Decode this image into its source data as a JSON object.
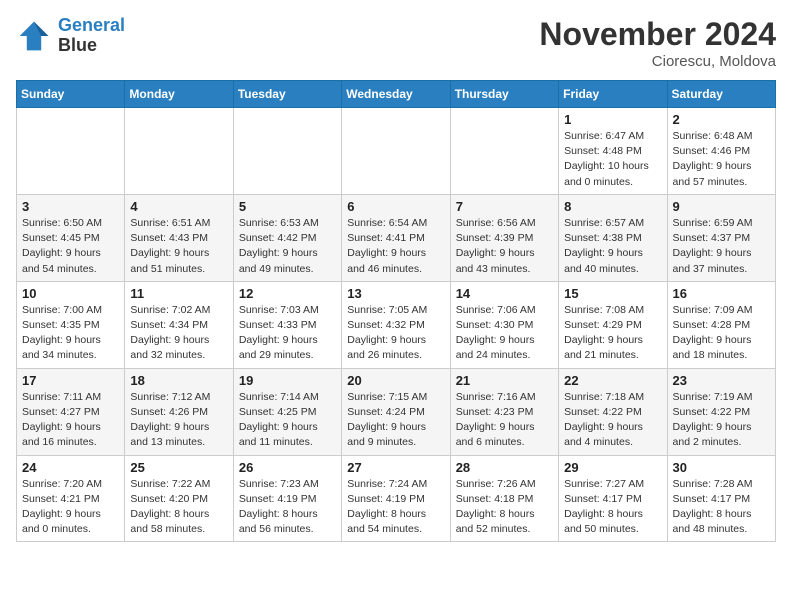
{
  "header": {
    "logo_line1": "General",
    "logo_line2": "Blue",
    "month": "November 2024",
    "location": "Ciorescu, Moldova"
  },
  "weekdays": [
    "Sunday",
    "Monday",
    "Tuesday",
    "Wednesday",
    "Thursday",
    "Friday",
    "Saturday"
  ],
  "weeks": [
    [
      {
        "day": "",
        "info": ""
      },
      {
        "day": "",
        "info": ""
      },
      {
        "day": "",
        "info": ""
      },
      {
        "day": "",
        "info": ""
      },
      {
        "day": "",
        "info": ""
      },
      {
        "day": "1",
        "info": "Sunrise: 6:47 AM\nSunset: 4:48 PM\nDaylight: 10 hours\nand 0 minutes."
      },
      {
        "day": "2",
        "info": "Sunrise: 6:48 AM\nSunset: 4:46 PM\nDaylight: 9 hours\nand 57 minutes."
      }
    ],
    [
      {
        "day": "3",
        "info": "Sunrise: 6:50 AM\nSunset: 4:45 PM\nDaylight: 9 hours\nand 54 minutes."
      },
      {
        "day": "4",
        "info": "Sunrise: 6:51 AM\nSunset: 4:43 PM\nDaylight: 9 hours\nand 51 minutes."
      },
      {
        "day": "5",
        "info": "Sunrise: 6:53 AM\nSunset: 4:42 PM\nDaylight: 9 hours\nand 49 minutes."
      },
      {
        "day": "6",
        "info": "Sunrise: 6:54 AM\nSunset: 4:41 PM\nDaylight: 9 hours\nand 46 minutes."
      },
      {
        "day": "7",
        "info": "Sunrise: 6:56 AM\nSunset: 4:39 PM\nDaylight: 9 hours\nand 43 minutes."
      },
      {
        "day": "8",
        "info": "Sunrise: 6:57 AM\nSunset: 4:38 PM\nDaylight: 9 hours\nand 40 minutes."
      },
      {
        "day": "9",
        "info": "Sunrise: 6:59 AM\nSunset: 4:37 PM\nDaylight: 9 hours\nand 37 minutes."
      }
    ],
    [
      {
        "day": "10",
        "info": "Sunrise: 7:00 AM\nSunset: 4:35 PM\nDaylight: 9 hours\nand 34 minutes."
      },
      {
        "day": "11",
        "info": "Sunrise: 7:02 AM\nSunset: 4:34 PM\nDaylight: 9 hours\nand 32 minutes."
      },
      {
        "day": "12",
        "info": "Sunrise: 7:03 AM\nSunset: 4:33 PM\nDaylight: 9 hours\nand 29 minutes."
      },
      {
        "day": "13",
        "info": "Sunrise: 7:05 AM\nSunset: 4:32 PM\nDaylight: 9 hours\nand 26 minutes."
      },
      {
        "day": "14",
        "info": "Sunrise: 7:06 AM\nSunset: 4:30 PM\nDaylight: 9 hours\nand 24 minutes."
      },
      {
        "day": "15",
        "info": "Sunrise: 7:08 AM\nSunset: 4:29 PM\nDaylight: 9 hours\nand 21 minutes."
      },
      {
        "day": "16",
        "info": "Sunrise: 7:09 AM\nSunset: 4:28 PM\nDaylight: 9 hours\nand 18 minutes."
      }
    ],
    [
      {
        "day": "17",
        "info": "Sunrise: 7:11 AM\nSunset: 4:27 PM\nDaylight: 9 hours\nand 16 minutes."
      },
      {
        "day": "18",
        "info": "Sunrise: 7:12 AM\nSunset: 4:26 PM\nDaylight: 9 hours\nand 13 minutes."
      },
      {
        "day": "19",
        "info": "Sunrise: 7:14 AM\nSunset: 4:25 PM\nDaylight: 9 hours\nand 11 minutes."
      },
      {
        "day": "20",
        "info": "Sunrise: 7:15 AM\nSunset: 4:24 PM\nDaylight: 9 hours\nand 9 minutes."
      },
      {
        "day": "21",
        "info": "Sunrise: 7:16 AM\nSunset: 4:23 PM\nDaylight: 9 hours\nand 6 minutes."
      },
      {
        "day": "22",
        "info": "Sunrise: 7:18 AM\nSunset: 4:22 PM\nDaylight: 9 hours\nand 4 minutes."
      },
      {
        "day": "23",
        "info": "Sunrise: 7:19 AM\nSunset: 4:22 PM\nDaylight: 9 hours\nand 2 minutes."
      }
    ],
    [
      {
        "day": "24",
        "info": "Sunrise: 7:20 AM\nSunset: 4:21 PM\nDaylight: 9 hours\nand 0 minutes."
      },
      {
        "day": "25",
        "info": "Sunrise: 7:22 AM\nSunset: 4:20 PM\nDaylight: 8 hours\nand 58 minutes."
      },
      {
        "day": "26",
        "info": "Sunrise: 7:23 AM\nSunset: 4:19 PM\nDaylight: 8 hours\nand 56 minutes."
      },
      {
        "day": "27",
        "info": "Sunrise: 7:24 AM\nSunset: 4:19 PM\nDaylight: 8 hours\nand 54 minutes."
      },
      {
        "day": "28",
        "info": "Sunrise: 7:26 AM\nSunset: 4:18 PM\nDaylight: 8 hours\nand 52 minutes."
      },
      {
        "day": "29",
        "info": "Sunrise: 7:27 AM\nSunset: 4:17 PM\nDaylight: 8 hours\nand 50 minutes."
      },
      {
        "day": "30",
        "info": "Sunrise: 7:28 AM\nSunset: 4:17 PM\nDaylight: 8 hours\nand 48 minutes."
      }
    ]
  ]
}
